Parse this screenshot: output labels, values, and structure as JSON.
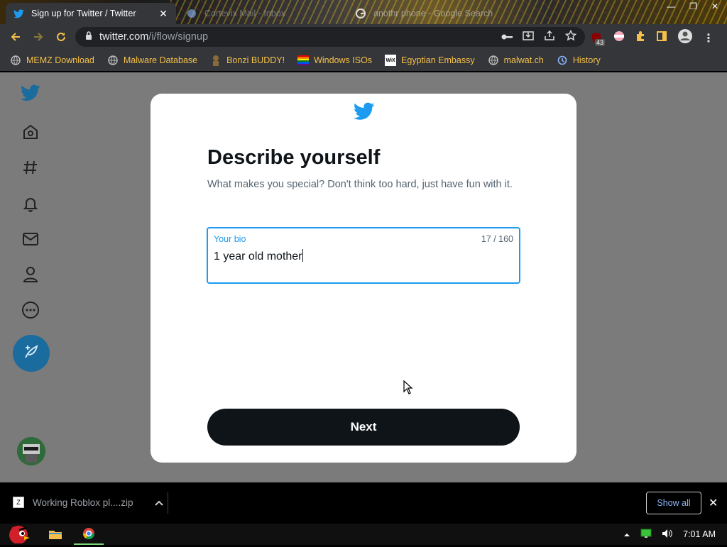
{
  "browser": {
    "tabs": [
      {
        "title": "Sign up for Twitter / Twitter",
        "active": true
      },
      {
        "title": "Cortevix Mail - Inbox",
        "active": false
      },
      {
        "title": "anothr phone - Google Search",
        "active": false
      }
    ],
    "url_host": "twitter.com",
    "url_path": "/i/flow/signup",
    "extension_badge": "43",
    "bookmarks": [
      {
        "label": "MEMZ Download",
        "icon": "globe-icon"
      },
      {
        "label": "Malware Database",
        "icon": "globe-icon"
      },
      {
        "label": "Bonzi BUDDY!",
        "icon": "bonzi-icon"
      },
      {
        "label": "Windows ISOs",
        "icon": "windows-flag-icon"
      },
      {
        "label": "Egyptian Embassy",
        "icon": "wix-icon"
      },
      {
        "label": "malwat.ch",
        "icon": "globe-icon"
      },
      {
        "label": "History",
        "icon": "history-icon"
      }
    ]
  },
  "modal": {
    "heading": "Describe yourself",
    "subtitle": "What makes you special? Don't think too hard, just have fun with it.",
    "bio_label": "Your bio",
    "bio_count": "17 / 160",
    "bio_value": "1 year old mother",
    "next_label": "Next"
  },
  "downloads": {
    "file_name": "Working Roblox pl....zip",
    "show_all": "Show all"
  },
  "taskbar": {
    "time": "7:01 AM"
  },
  "colors": {
    "twitter_blue": "#1d9bf0",
    "bookmark_text": "#f5c04a",
    "button_dark": "#0f1419"
  }
}
